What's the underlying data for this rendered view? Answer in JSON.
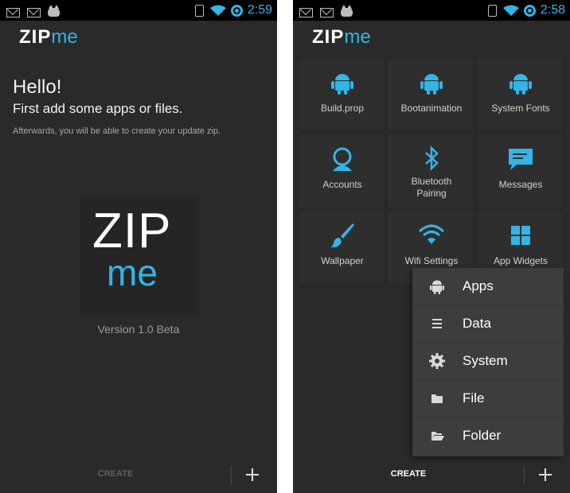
{
  "status_bar": {
    "left_time": "2:59",
    "right_time": "2:58"
  },
  "app": {
    "logo_zip": "ZIP",
    "logo_me": "me"
  },
  "welcome": {
    "hello": "Hello!",
    "instruction": "First add some apps or files.",
    "subtext": "Afterwards, you will be able to create your update zip.",
    "big_logo_zip": "ZIP",
    "big_logo_me": "me",
    "version": "Version 1.0 Beta"
  },
  "bottom_bar": {
    "create_label": "CREATE",
    "add_label": "+"
  },
  "tiles": [
    {
      "label": "Build.prop",
      "icon": "android-icon"
    },
    {
      "label": "Bootanimation",
      "icon": "android-icon"
    },
    {
      "label": "System Fonts",
      "icon": "android-icon"
    },
    {
      "label": "Accounts",
      "icon": "person-icon"
    },
    {
      "label": "Bluetooth\nPairing",
      "icon": "bluetooth-icon"
    },
    {
      "label": "Messages",
      "icon": "message-icon"
    },
    {
      "label": "Wallpaper",
      "icon": "brush-icon"
    },
    {
      "label": "Wifi Settings",
      "icon": "wifi-icon"
    },
    {
      "label": "App Widgets",
      "icon": "widgets-icon"
    }
  ],
  "popup_menu": [
    {
      "label": "Apps",
      "icon": "android-icon"
    },
    {
      "label": "Data",
      "icon": "list-icon"
    },
    {
      "label": "System",
      "icon": "gear-icon"
    },
    {
      "label": "File",
      "icon": "file-folder-icon"
    },
    {
      "label": "Folder",
      "icon": "open-folder-icon"
    }
  ],
  "colors": {
    "accent": "#33b5e5",
    "background": "#2a2a2a",
    "status_bar": "#000000"
  }
}
